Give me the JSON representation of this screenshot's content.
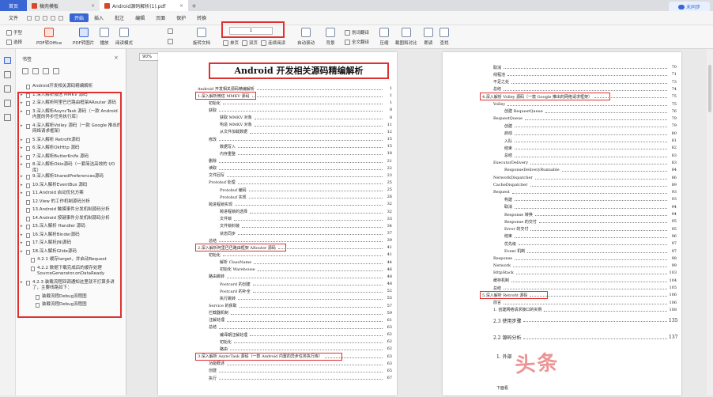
{
  "tabs": [
    {
      "label": "首页"
    },
    {
      "label": "稿壳模板"
    },
    {
      "label": "Android源码解析(1).pdf"
    }
  ],
  "menu": {
    "file": "文件",
    "items": [
      "开始",
      "插入",
      "批注",
      "编辑",
      "页面",
      "保护",
      "转换"
    ],
    "active": "开始",
    "cloud": "未同步"
  },
  "toolbar": {
    "hand": "手型",
    "select": "选择",
    "pdf_office": "PDF转Office",
    "pdf_image": "PDF转图片",
    "play": "播放",
    "read_mode": "阅读模式",
    "zoom": "90%",
    "rotate": "旋转文档",
    "single": "单页",
    "double": "双页",
    "continuous": "连续阅读",
    "page_value": "1",
    "auto_scroll": "自动滚动",
    "background": "背景",
    "translate": "划词翻译",
    "full_translate": "全文翻译",
    "compress": "压缩",
    "screenshot": "截图和对比",
    "read_aloud": "朗读",
    "find": "查找"
  },
  "bookmarks": {
    "title": "书签",
    "items": [
      {
        "label": "Android开发相关源码精编解析",
        "arrow": false
      },
      {
        "label": "1.深入解析微信 MMKV 源码",
        "arrow": true
      },
      {
        "label": "2.深入解析阿里巴巴路由框架ARouter 源码",
        "arrow": true
      },
      {
        "label": "3.深入解析AsyncTask 源码（一款 Android 内置的异步任务执行库）",
        "arrow": true
      },
      {
        "label": "4.深入解析Volley 源码（一款 Google 推出的网络请求框架）",
        "arrow": true
      },
      {
        "label": "5.深入解析 Retrofit源码",
        "arrow": true
      },
      {
        "label": "6.深入解析OkHttp 源码",
        "arrow": true
      },
      {
        "label": "7.深入解析ButterKnife 源码",
        "arrow": true
      },
      {
        "label": "8.深入解析Okio源码（一套简洁高效的 I/O 库）",
        "arrow": true
      },
      {
        "label": "9.深入解析SharedPreferences源码",
        "arrow": true
      },
      {
        "label": "10.深入解析EventBus 源码",
        "arrow": true
      },
      {
        "label": "11.Android 启动优化方案",
        "arrow": true
      },
      {
        "label": "12.View 的工作机制源码分析",
        "arrow": false
      },
      {
        "label": "13.Android 触摸事件分发机制源码分析",
        "arrow": false
      },
      {
        "label": "14.Android 按键事件分发机制源码分析",
        "arrow": false
      },
      {
        "label": "15.深入解析 Handler 源码",
        "arrow": true
      },
      {
        "label": "16.深入解析Binder源码",
        "arrow": true
      },
      {
        "label": "17.深入解析JNI源码",
        "arrow": true
      },
      {
        "label": "18.深入解析Glide源码",
        "arrow": true
      },
      {
        "label": "4.2.1 缓存target，并启动Request",
        "arrow": false
      },
      {
        "label": "4.2.2 数据下载完成后的缓存处理SourceGenerator.onDataReady",
        "arrow": false
      },
      {
        "label": "4.2.3 装载流程回调通知这里就不打算多讲了，主要线路如下：",
        "arrow": true
      },
      {
        "label": "装载流程Debug流程图",
        "arrow": false
      },
      {
        "label": "装载流程Debug流程图",
        "arrow": false
      }
    ]
  },
  "page1": {
    "title": "Android 开发相关源码精编解析",
    "rows": [
      {
        "t": "Android 开发相关源码精编解析",
        "n": "1",
        "i": 0
      },
      {
        "t": "1.深入解析微信 MMKV 源码",
        "n": "1",
        "i": 0,
        "red": true
      },
      {
        "t": "初始化",
        "n": "1",
        "i": 1
      },
      {
        "t": "获取",
        "n": "8",
        "i": 1
      },
      {
        "t": "获取 MMKV 对象",
        "n": "8",
        "i": 2
      },
      {
        "t": "构造 MMKV 对象",
        "n": "11",
        "i": 2
      },
      {
        "t": "从文件加载数据",
        "n": "12",
        "i": 2
      },
      {
        "t": "修改",
        "n": "15",
        "i": 1
      },
      {
        "t": "数据写入",
        "n": "15",
        "i": 2
      },
      {
        "t": "内存重整",
        "n": "18",
        "i": 2
      },
      {
        "t": "删除",
        "n": "21",
        "i": 1
      },
      {
        "t": "读取",
        "n": "22",
        "i": 1
      },
      {
        "t": "文件回写",
        "n": "23",
        "i": 1
      },
      {
        "t": "Protobuf 处理",
        "n": "25",
        "i": 1
      },
      {
        "t": "Protobuf 编码",
        "n": "25",
        "i": 2
      },
      {
        "t": "Protobuf 实现",
        "n": "26",
        "i": 2
      },
      {
        "t": "跨进程锁实现",
        "n": "32",
        "i": 1
      },
      {
        "t": "跨进程锁的选择",
        "n": "32",
        "i": 2
      },
      {
        "t": "文件锁",
        "n": "33",
        "i": 2
      },
      {
        "t": "文件锁封装",
        "n": "34",
        "i": 2
      },
      {
        "t": "状态同步",
        "n": "37",
        "i": 2
      },
      {
        "t": "总结",
        "n": "39",
        "i": 1
      },
      {
        "t": "2.深入解析阿里巴巴路由框架 ARouter 源码",
        "n": "41",
        "i": 0,
        "red": true
      },
      {
        "t": "初始化",
        "n": "41",
        "i": 1
      },
      {
        "t": "解析 ClassName",
        "n": "44",
        "i": 2
      },
      {
        "t": "初始化 Warehouse",
        "n": "46",
        "i": 2
      },
      {
        "t": "路由跳转",
        "n": "48",
        "i": 1
      },
      {
        "t": "Postcard 的创建",
        "n": "48",
        "i": 2
      },
      {
        "t": "Postcard 的补全",
        "n": "52",
        "i": 2
      },
      {
        "t": "执行跳转",
        "n": "55",
        "i": 2
      },
      {
        "t": "Service 的获取",
        "n": "57",
        "i": 1
      },
      {
        "t": "拦截器机制",
        "n": "59",
        "i": 1
      },
      {
        "t": "注解处理",
        "n": "61",
        "i": 1
      },
      {
        "t": "总结",
        "n": "63",
        "i": 1
      },
      {
        "t": "编译期注解处理",
        "n": "62",
        "i": 2
      },
      {
        "t": "初始化",
        "n": "62",
        "i": 2
      },
      {
        "t": "路由",
        "n": "62",
        "i": 2
      },
      {
        "t": "3.深入解析 AsyncTask 源码（一款 Android 内置的异步任务执行库）",
        "n": "63",
        "i": 0,
        "red": true
      },
      {
        "t": "功能概述",
        "n": "63",
        "i": 1
      },
      {
        "t": "创建",
        "n": "65",
        "i": 1
      },
      {
        "t": "执行",
        "n": "67",
        "i": 1
      }
    ]
  },
  "page2": {
    "rows": [
      {
        "t": "取消",
        "n": "70",
        "i": 1
      },
      {
        "t": "线程池",
        "n": "71",
        "i": 1
      },
      {
        "t": "不足之处",
        "n": "73",
        "i": 1
      },
      {
        "t": "总结",
        "n": "74",
        "i": 1
      },
      {
        "t": "4.深入解析 Volley 源码（一款 Google 推出的网络请求框架）",
        "n": "75",
        "i": 0,
        "red": true
      },
      {
        "t": "Volley",
        "n": "75",
        "i": 1
      },
      {
        "t": "创建 RequestQueue",
        "n": "76",
        "i": 2
      },
      {
        "t": "RequestQueue",
        "n": "79",
        "i": 1
      },
      {
        "t": "创建",
        "n": "79",
        "i": 2
      },
      {
        "t": "启动",
        "n": "80",
        "i": 2
      },
      {
        "t": "入队",
        "n": "81",
        "i": 2
      },
      {
        "t": "结束",
        "n": "82",
        "i": 2
      },
      {
        "t": "总结",
        "n": "83",
        "i": 2
      },
      {
        "t": "ExecutorDelivery",
        "n": "83",
        "i": 1
      },
      {
        "t": "ResponseDeliveryRunnable",
        "n": "84",
        "i": 2
      },
      {
        "t": "NetworkDispatcher",
        "n": "86",
        "i": 1
      },
      {
        "t": "CacheDispatcher",
        "n": "89",
        "i": 1
      },
      {
        "t": "Request",
        "n": "93",
        "i": 1
      },
      {
        "t": "构建",
        "n": "93",
        "i": 2
      },
      {
        "t": "取消",
        "n": "94",
        "i": 2
      },
      {
        "t": "Response 转换",
        "n": "94",
        "i": 2
      },
      {
        "t": "Response 的交付",
        "n": "95",
        "i": 2
      },
      {
        "t": "Error 的交付",
        "n": "95",
        "i": 2
      },
      {
        "t": "结束",
        "n": "96",
        "i": 2
      },
      {
        "t": "优先级",
        "n": "97",
        "i": 2
      },
      {
        "t": "Event 机制",
        "n": "97",
        "i": 2
      },
      {
        "t": "Response",
        "n": "98",
        "i": 1
      },
      {
        "t": "Network",
        "n": "99",
        "i": 1
      },
      {
        "t": "HttpStack",
        "n": "103",
        "i": 1
      },
      {
        "t": "缓存机制",
        "n": "104",
        "i": 1
      },
      {
        "t": "总结",
        "n": "105",
        "i": 1
      },
      {
        "t": "5.深入解析 Retrofit 源码",
        "n": "106",
        "i": 0,
        "red": true
      },
      {
        "t": "前言",
        "n": "106",
        "i": 1
      },
      {
        "t": "1. 创建网络请求接口的实例",
        "n": "108",
        "i": 1
      },
      {
        "t": "2.3 使用步骤",
        "n": "135",
        "i": 1,
        "big": true
      },
      {
        "t": "2.2 源码分析",
        "n": "137",
        "i": 1,
        "big": true
      }
    ],
    "extra1": "1. 外部",
    "extra2": "下面看"
  },
  "watermark": "头条"
}
